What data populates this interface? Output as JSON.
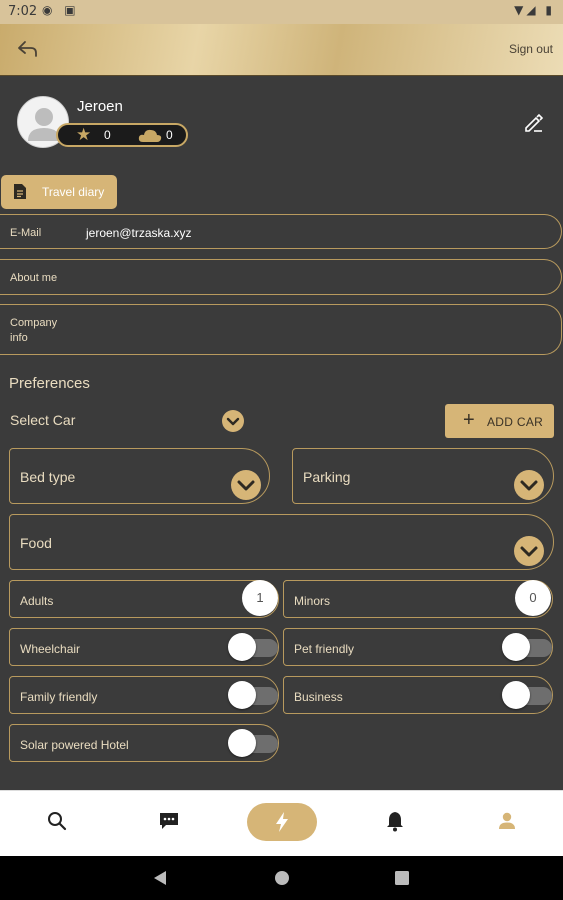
{
  "status_bar": {
    "time": "7:02"
  },
  "app_bar": {
    "signout_label": "Sign out"
  },
  "profile": {
    "name": "Jeroen",
    "stars_count": "0",
    "cloud_count": "0"
  },
  "travel_diary": {
    "label": "Travel diary"
  },
  "fields": {
    "email_label": "E-Mail",
    "email_value": "jeroen@trzaska.xyz",
    "about_label": "About me",
    "company_label_line1": "Company",
    "company_label_line2": "info"
  },
  "preferences": {
    "title": "Preferences",
    "select_car": "Select Car",
    "add_car": "ADD CAR",
    "bed_type": "Bed type",
    "parking": "Parking",
    "food": "Food",
    "adults_label": "Adults",
    "adults_value": "1",
    "minors_label": "Minors",
    "minors_value": "0",
    "wheelchair": "Wheelchair",
    "pet_friendly": "Pet friendly",
    "family_friendly": "Family friendly",
    "business": "Business",
    "solar_hotel": "Solar powered Hotel"
  },
  "toggles": {
    "wheelchair": false,
    "pet_friendly": false,
    "family_friendly": false,
    "business": false,
    "solar_hotel": false
  },
  "bottom_nav": [
    "search-icon",
    "chat-icon",
    "bolt-icon",
    "bell-icon",
    "person-icon"
  ],
  "colors": {
    "accent": "#d6b577",
    "background": "#3b3b3b",
    "border": "#b89a5e"
  }
}
